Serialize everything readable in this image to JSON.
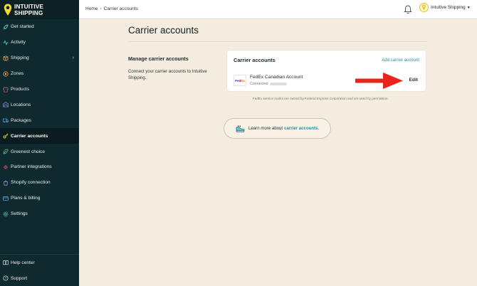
{
  "brand": {
    "line1": "INTUITIVE",
    "line2": "SHIPPING"
  },
  "sidebar": {
    "items": [
      {
        "label": "Get started",
        "icon": "rocket-icon"
      },
      {
        "label": "Activity",
        "icon": "activity-icon"
      },
      {
        "label": "Shipping",
        "icon": "shipping-icon"
      },
      {
        "label": "Zones",
        "icon": "zones-icon"
      },
      {
        "label": "Products",
        "icon": "shirt-icon"
      },
      {
        "label": "Locations",
        "icon": "warehouse-icon"
      },
      {
        "label": "Packages",
        "icon": "truck-icon"
      },
      {
        "label": "Carrier accounts",
        "icon": "key-icon"
      },
      {
        "label": "Greenest choice",
        "icon": "leaf-icon"
      },
      {
        "label": "Partner integrations",
        "icon": "plug-icon"
      },
      {
        "label": "Shopify connection",
        "icon": "shopify-icon"
      },
      {
        "label": "Plans & billing",
        "icon": "billing-icon"
      },
      {
        "label": "Settings",
        "icon": "gear-icon"
      }
    ],
    "active": "Carrier accounts",
    "bottom": [
      {
        "label": "Help center",
        "icon": "book-icon"
      },
      {
        "label": "Support",
        "icon": "help-icon"
      }
    ]
  },
  "topbar": {
    "breadcrumb": {
      "home": "Home",
      "separator": "›",
      "current": "Carrier accounts"
    },
    "user_name": "Intuitive Shipping"
  },
  "main": {
    "title": "Carrier accounts",
    "section_heading": "Manage carrier accounts",
    "section_desc": "Connect your carrier accounts to Intuitive Shipping.",
    "card": {
      "title": "Carrier accounts",
      "add_link": "Add carrier account",
      "account": {
        "logo_fed": "Fed",
        "logo_ex": "Ex",
        "name": "FedEx Canadian Account",
        "status": "Connected",
        "edit": "Edit"
      }
    },
    "fine_print": "FedEx service marks are owned by Federal Express Corporation and are used by permission.",
    "learn": {
      "text": "Learn more about",
      "link": "carrier accounts."
    }
  },
  "colors": {
    "sidebar_bg": "#0f2a2f",
    "page_bg": "#f4ecdf",
    "accent_link": "#2a8aa0",
    "arrow": "#e8241b",
    "brand_yellow": "#f2d935"
  }
}
